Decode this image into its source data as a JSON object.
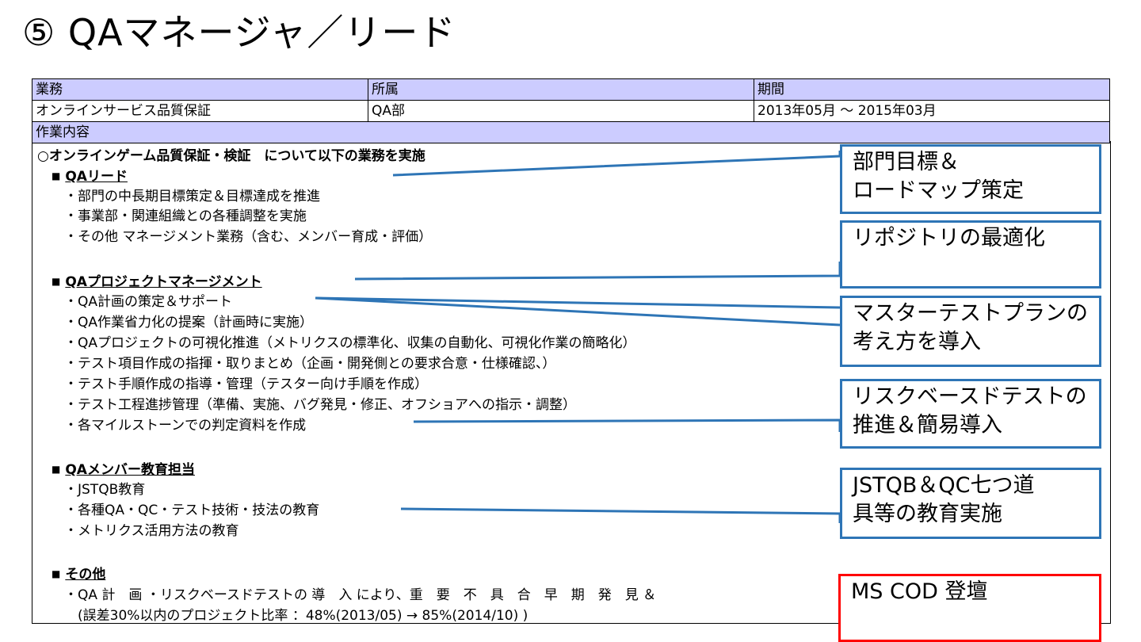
{
  "title": "⑤ QAマネージャ／リード",
  "table": {
    "headers": [
      "業務",
      "所属",
      "期間"
    ],
    "values": [
      "オンラインサービス品質保証",
      "QA部",
      "2013年05月 ～ 2015年03月"
    ],
    "content_header": "作業内容"
  },
  "content": {
    "intro": "○オンラインゲーム品質保証・検証　について以下の業務を実施",
    "bullet": "■",
    "sections": [
      {
        "heading": "QAリード",
        "items": [
          "・部門の中長期目標策定＆目標達成を推進",
          "・事業部・関連組織との各種調整を実施",
          "・その他 マネージメント業務（含む、メンバー育成・評価）"
        ]
      },
      {
        "heading": "QAプロジェクトマネージメント",
        "items": [
          "・QA計画の策定＆サポート",
          "・QA作業省力化の提案（計画時に実施）",
          "・QAプロジェクトの可視化推進（メトリクスの標準化、収集の自動化、可視化作業の簡略化）",
          "・テスト項目作成の指揮・取りまとめ（企画・開発側との要求合意・仕様確認、）",
          "・テスト手順作成の指導・管理（テスター向け手順を作成）",
          "・テスト工程進捗管理（準備、実施、バグ発見・修正、オフショアへの指示・調整）",
          "・各マイルストーンでの判定資料を作成"
        ]
      },
      {
        "heading": "QAメンバー教育担当",
        "items": [
          "・JSTQB教育",
          "・各種QA・QC・テスト技術・技法の教育",
          "・メトリクス活用方法の教育"
        ]
      },
      {
        "heading": "その他",
        "items": [
          "・QA 計　画 ・リスクベースドテストの 導　入 により、重　要　不　具　合　早　期　発　見 ＆",
          "　(誤差30%以内のプロジェクト比率 ：48%(2013/05) → 85%(2014/10) )"
        ]
      }
    ]
  },
  "callouts": [
    {
      "line1": "部門目標＆",
      "line2": "ロードマップ策定",
      "color": "#2e75b6"
    },
    {
      "line1": "リポジトリの最適化",
      "line2": "",
      "color": "#2e75b6"
    },
    {
      "line1": "マスターテストプランの",
      "line2": "考え方を導入",
      "color": "#2e75b6"
    },
    {
      "line1": "リスクベースドテストの",
      "line2": "推進＆簡易導入",
      "color": "#2e75b6"
    },
    {
      "line1": "JSTQB＆QC七つ道",
      "line2": "具等の教育実施",
      "color": "#2e75b6"
    },
    {
      "line1": "MS COD 登壇",
      "line2": "",
      "color": "#ff0000"
    }
  ],
  "connector_color": "#2e75b6"
}
